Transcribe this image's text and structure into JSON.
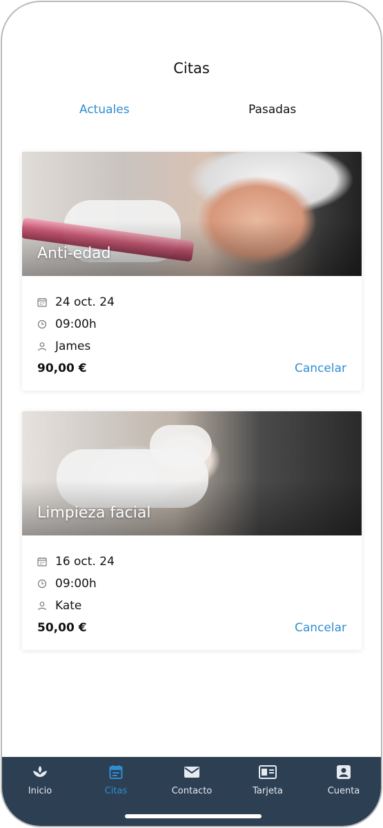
{
  "header": {
    "title": "Citas"
  },
  "tabs": [
    {
      "label": "Actuales",
      "active": true
    },
    {
      "label": "Pasadas",
      "active": false
    }
  ],
  "appointments": [
    {
      "service": "Anti-edad",
      "date": "24 oct. 24",
      "time": "09:00h",
      "professional": "James",
      "price": "90,00 €",
      "action": "Cancelar"
    },
    {
      "service": "Limpieza facial",
      "date": "16 oct. 24",
      "time": "09:00h",
      "professional": "Kate",
      "price": "50,00 €",
      "action": "Cancelar"
    }
  ],
  "nav": [
    {
      "label": "Inicio",
      "icon": "lotus-icon",
      "active": false
    },
    {
      "label": "Citas",
      "icon": "calendar-icon",
      "active": true
    },
    {
      "label": "Contacto",
      "icon": "mail-icon",
      "active": false
    },
    {
      "label": "Tarjeta",
      "icon": "id-card-icon",
      "active": false
    },
    {
      "label": "Cuenta",
      "icon": "account-icon",
      "active": false
    }
  ],
  "colors": {
    "accent": "#2f8dd0",
    "nav_background": "#2d3f53",
    "nav_text": "#e6ebf0"
  }
}
